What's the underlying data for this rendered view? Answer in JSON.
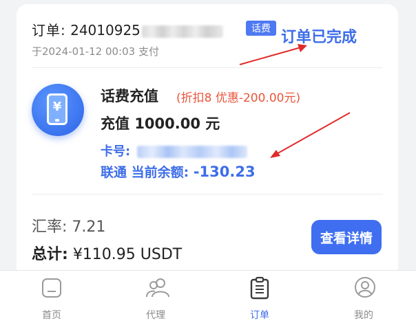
{
  "order": {
    "label": "订单:",
    "number_visible": "24010925",
    "type_tag": "话费",
    "time_prefix": "于",
    "datetime": "2024-01-12 00:03",
    "status": "支付"
  },
  "annotation": {
    "text": "订单已完成",
    "color": "#3d6de8"
  },
  "product": {
    "icon": "phone-yen-icon",
    "icon_symbol": "¥",
    "name": "话费充值",
    "discount": "(折扣8 优惠-200.00元)",
    "amount_label": "充值",
    "amount": "1000.00",
    "amount_unit": "元",
    "card_label": "卡号:",
    "balance_label": "联通 当前余额:",
    "balance": "-130.23"
  },
  "summary": {
    "rate_label": "汇率:",
    "rate": "7.21",
    "total_label": "总计:",
    "total": "¥110.95 USDT",
    "detail_button": "查看详情"
  },
  "tabs": [
    {
      "label": "首页",
      "icon": "home-icon"
    },
    {
      "label": "代理",
      "icon": "agent-users-icon"
    },
    {
      "label": "订单",
      "icon": "order-clipboard-icon",
      "active": true
    },
    {
      "label": "我的",
      "icon": "profile-icon"
    }
  ],
  "colors": {
    "accent": "#3d6de8",
    "discount": "#e8563c",
    "tag_bg": "#4e79f2"
  }
}
